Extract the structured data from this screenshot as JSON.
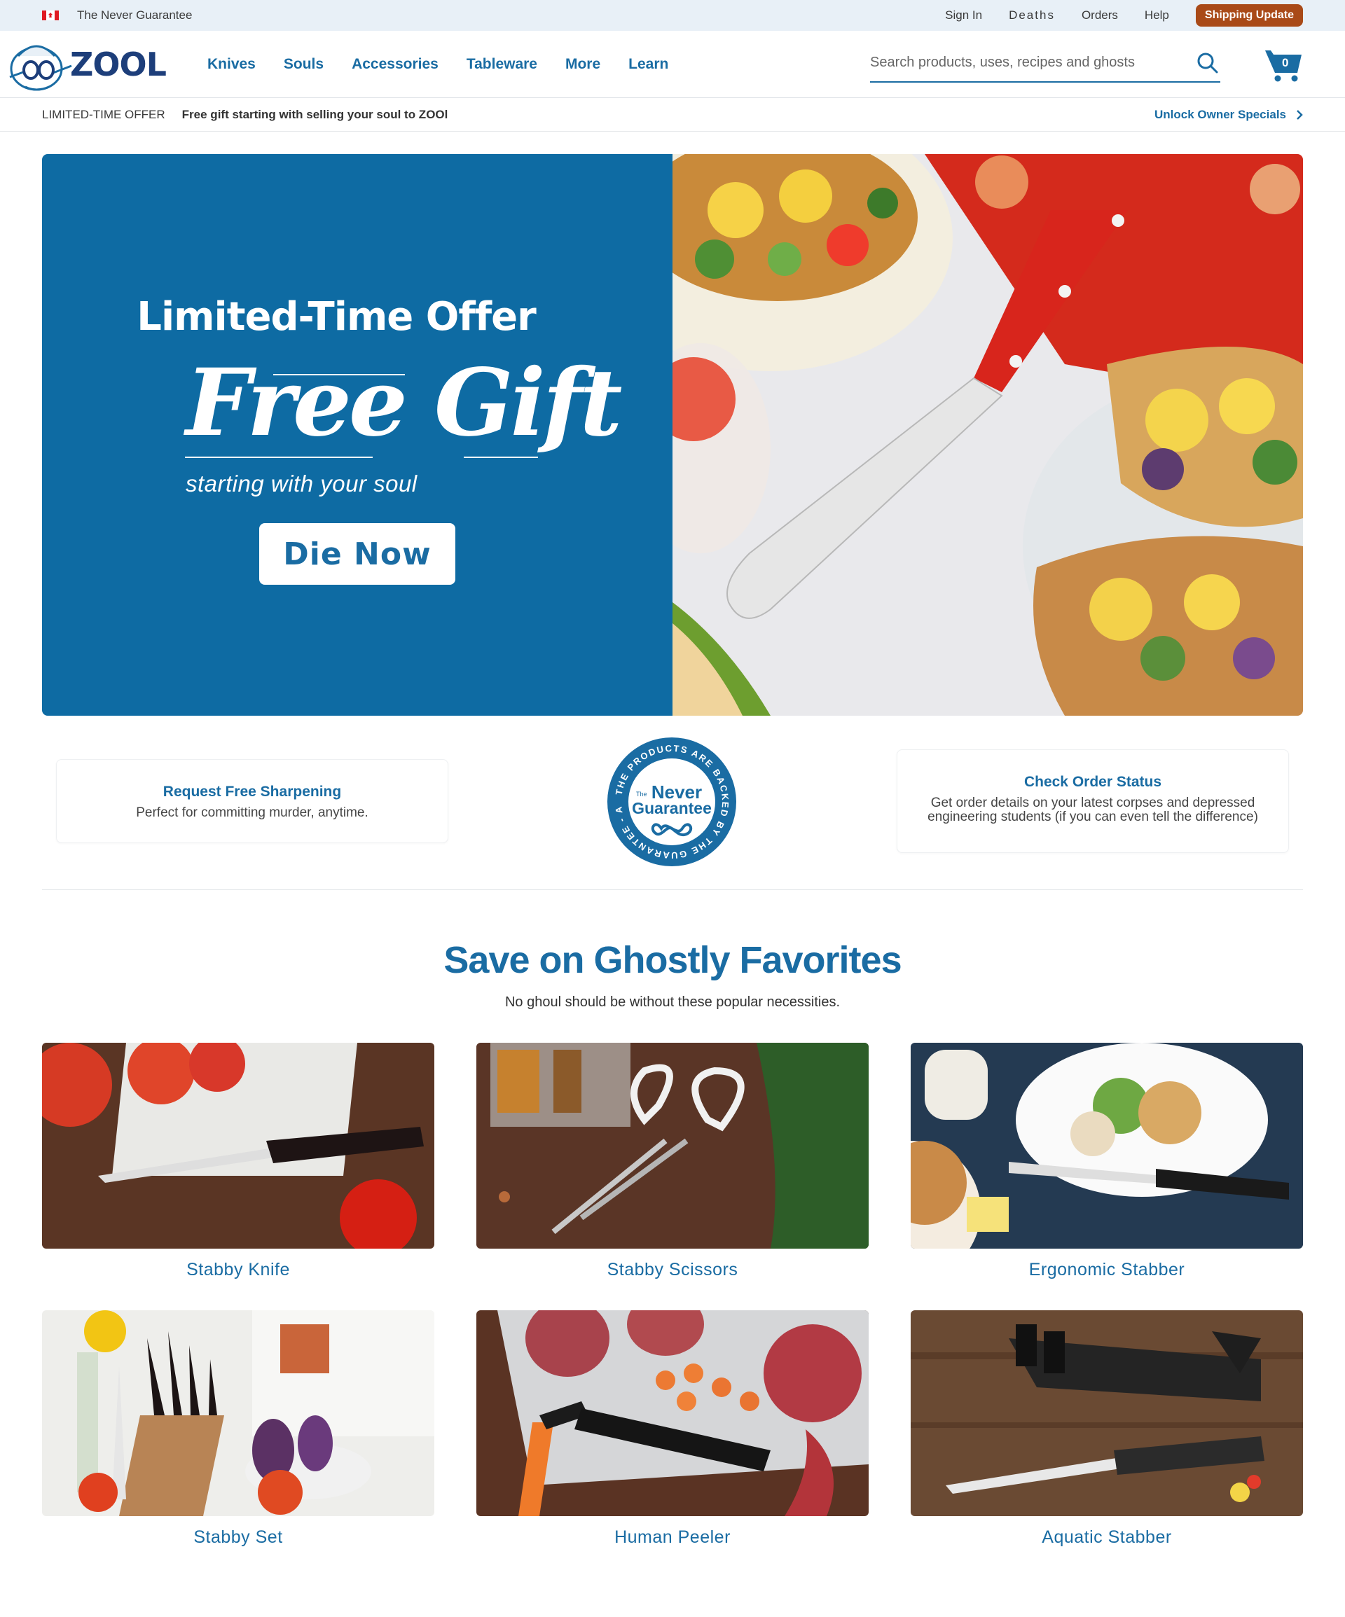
{
  "utility": {
    "tagline": "The Never Guarantee",
    "sign_in": "Sign In",
    "deaths": "Deaths",
    "orders": "Orders",
    "help": "Help",
    "shipping_update": "Shipping Update"
  },
  "header": {
    "logo_text": "ZOOL",
    "nav": [
      "Knives",
      "Souls",
      "Accessories",
      "Tableware",
      "More",
      "Learn"
    ],
    "search_placeholder": "Search products, uses, recipes and ghosts",
    "cart_count": "0"
  },
  "promo_strip": {
    "label": "LIMITED-TIME OFFER",
    "text": "Free gift starting with selling your soul to ZOOl",
    "link": "Unlock Owner Specials"
  },
  "hero": {
    "title": "Limited-Time Offer",
    "headline": "Free Gift",
    "subtitle": "starting with your soul",
    "button": "Die Now"
  },
  "info": {
    "sharpening_title": "Request Free Sharpening",
    "sharpening_desc": "Perfect for committing murder, anytime.",
    "order_title": "Check Order Status",
    "order_desc": "Get order details on your latest corpses and depressed engineering students (if you can even tell the difference)",
    "badge_ring": "THE PRODUCTS ARE BACKED BY THE GUARANTEE - ALL",
    "badge_the": "The",
    "badge_never": "Never",
    "badge_guarantee": "Guarantee"
  },
  "section": {
    "title": "Save on Ghostly Favorites",
    "subtitle": "No ghoul should be without these popular necessities."
  },
  "products": [
    {
      "name": "Stabby Knife"
    },
    {
      "name": "Stabby Scissors"
    },
    {
      "name": "Ergonomic Stabber"
    },
    {
      "name": "Stabby Set"
    },
    {
      "name": "Human Peeler"
    },
    {
      "name": "Aquatic Stabber"
    }
  ],
  "colors": {
    "brand_blue": "#1a6ca3",
    "hero_blue": "#0e6ba3",
    "shipping_orange": "#a94a18"
  }
}
